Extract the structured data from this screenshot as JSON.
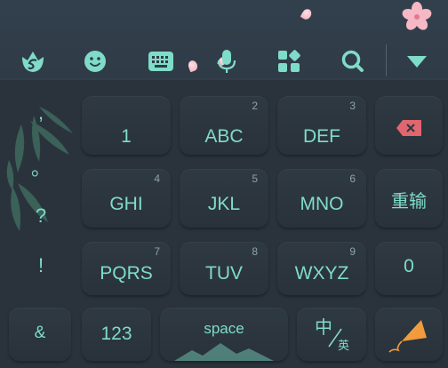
{
  "toolbar": {
    "icons": [
      "ime-logo-icon",
      "emoji-icon",
      "keyboard-icon",
      "microphone-icon",
      "apps-icon",
      "search-icon",
      "collapse-triangle-icon"
    ]
  },
  "symbols": [
    ",",
    "。",
    "?",
    "!"
  ],
  "keys": {
    "row1": [
      {
        "label": "1",
        "digit": ""
      },
      {
        "label": "ABC",
        "digit": "2"
      },
      {
        "label": "DEF",
        "digit": "3"
      }
    ],
    "row2": [
      {
        "label": "GHI",
        "digit": "4"
      },
      {
        "label": "JKL",
        "digit": "5"
      },
      {
        "label": "MNO",
        "digit": "6"
      }
    ],
    "row3": [
      {
        "label": "PQRS",
        "digit": "7"
      },
      {
        "label": "TUV",
        "digit": "8"
      },
      {
        "label": "WXYZ",
        "digit": "9"
      }
    ],
    "reinput": "重输",
    "zero": "0",
    "ampersand": "&",
    "num123": "123",
    "space": "space",
    "lang_top": "中",
    "lang_bottom": "英"
  },
  "colors": {
    "accent": "#7fdcc8",
    "delete": "#e0666f",
    "key_bg": "#2f3942"
  }
}
